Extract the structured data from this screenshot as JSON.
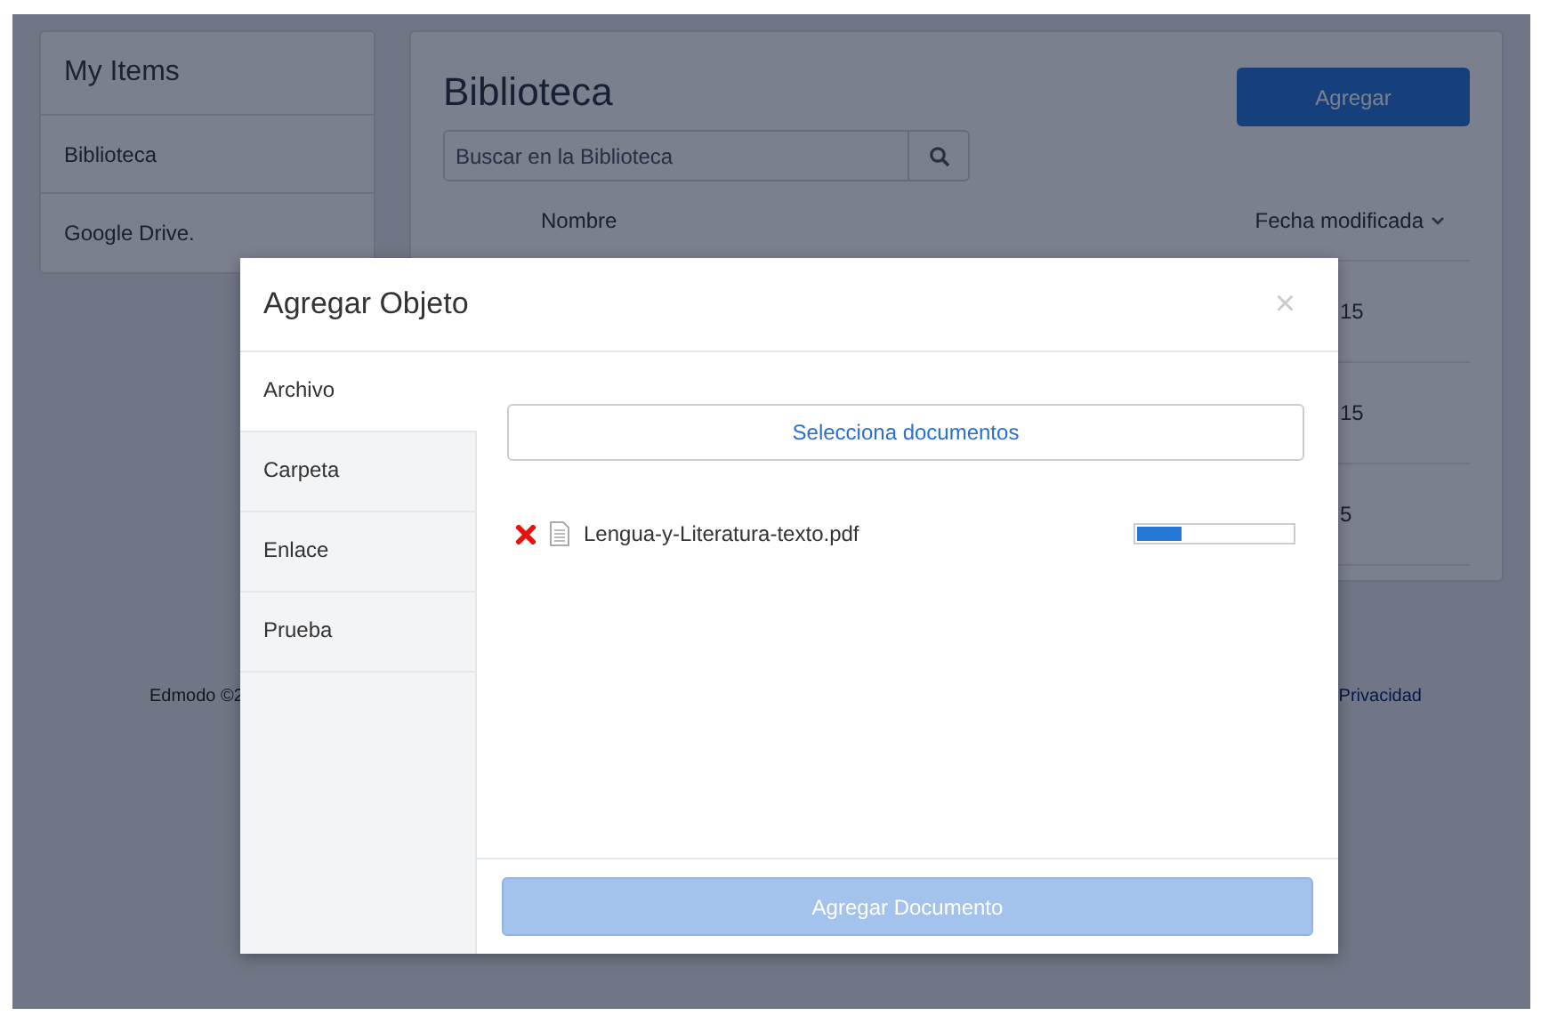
{
  "sidebar": {
    "title": "My Items",
    "items": [
      {
        "label": "Biblioteca"
      },
      {
        "label": "Google Drive."
      }
    ]
  },
  "library": {
    "title": "Biblioteca",
    "add_button": "Agregar",
    "search": {
      "placeholder": "Buscar en la Biblioteca"
    },
    "columns": [
      {
        "label": "Nombre",
        "sorted": false
      },
      {
        "label": "Fecha modificada",
        "sorted": true
      }
    ],
    "rows": [
      {
        "fecha_modificada": "15"
      },
      {
        "fecha_modificada": "15"
      },
      {
        "fecha_modificada": "5"
      }
    ]
  },
  "footer": {
    "copyright": "Edmodo ©2",
    "privacy_link": "Privacidad"
  },
  "dialog": {
    "title": "Agregar Objeto",
    "close": "×",
    "tabs": [
      {
        "label": "Archivo",
        "selected": true
      },
      {
        "label": "Carpeta",
        "selected": false
      },
      {
        "label": "Enlace",
        "selected": false
      },
      {
        "label": "Prueba",
        "selected": false
      }
    ],
    "select_button": "Selecciona documentos",
    "files": [
      {
        "name": "Lengua-y-Literatura-texto.pdf",
        "level": 0.29
      }
    ],
    "submit_button": {
      "label": "Agregar Documento",
      "disabled": true
    }
  }
}
